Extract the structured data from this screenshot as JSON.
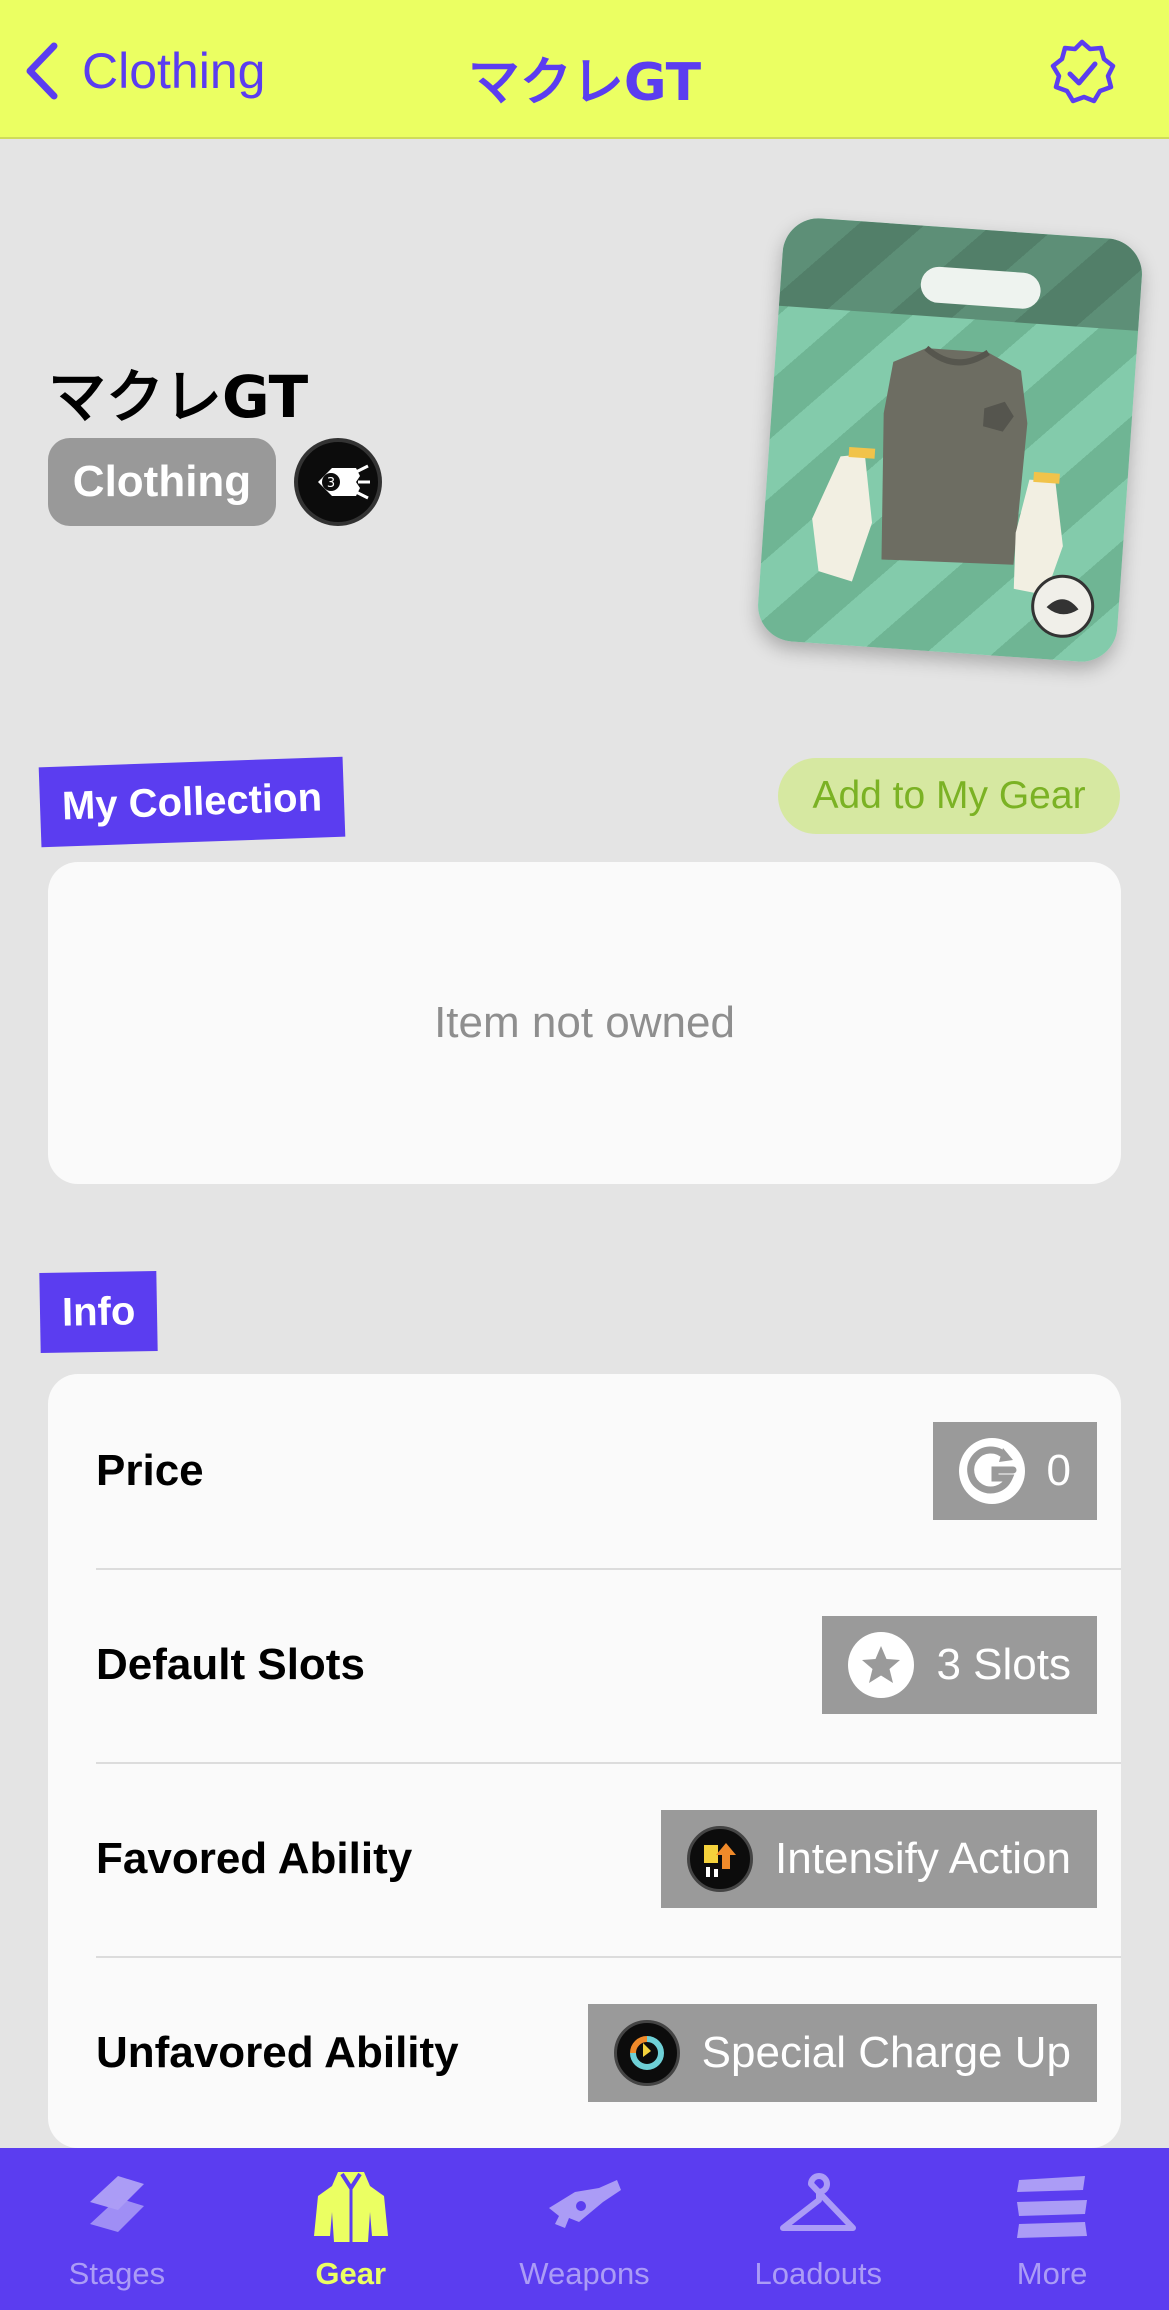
{
  "nav": {
    "back_label": "Clothing",
    "title": "マクレGT"
  },
  "item": {
    "name": "マクレGT",
    "category": "Clothing",
    "brand_icon": "brand-squid-icon"
  },
  "collection": {
    "heading": "My Collection",
    "add_button": "Add to My Gear",
    "empty_text": "Item not owned"
  },
  "info": {
    "heading": "Info",
    "rows": [
      {
        "label": "Price",
        "value": "0",
        "icon": "currency-icon"
      },
      {
        "label": "Default Slots",
        "value": "3 Slots",
        "icon": "star-icon"
      },
      {
        "label": "Favored Ability",
        "value": "Intensify Action",
        "icon": "intensify-action-icon"
      },
      {
        "label": "Unfavored Ability",
        "value": "Special Charge Up",
        "icon": "special-charge-up-icon"
      }
    ]
  },
  "tabs": [
    {
      "label": "Stages",
      "active": false
    },
    {
      "label": "Gear",
      "active": true
    },
    {
      "label": "Weapons",
      "active": false
    },
    {
      "label": "Loadouts",
      "active": false
    },
    {
      "label": "More",
      "active": false
    }
  ],
  "colors": {
    "accent": "#5b3df0",
    "nav_bg": "#ebff62",
    "add_button_bg": "#d6e8a1",
    "add_button_text": "#7bb224"
  }
}
